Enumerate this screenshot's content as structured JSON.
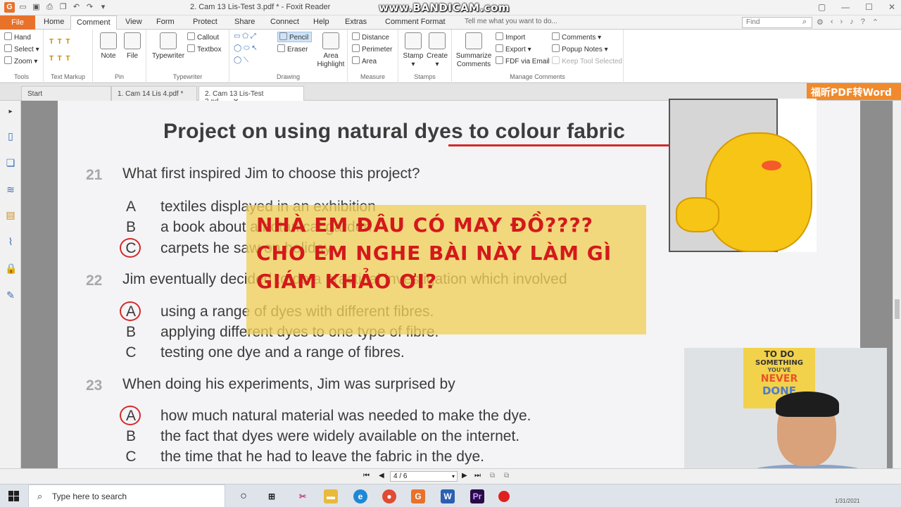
{
  "app": {
    "window_title": "2. Cam 13 Lis-Test 3.pdf * - Foxit Reader",
    "watermark": "www.BANDICAM.com"
  },
  "menu": {
    "tabs": [
      "File",
      "Home",
      "Comment",
      "View",
      "Form",
      "Protect",
      "Share",
      "Connect",
      "Help",
      "Extras",
      "Comment Format"
    ],
    "active_tab": "Comment",
    "tell_me": "Tell me what you want to do...",
    "find_placeholder": "Find"
  },
  "ribbon": {
    "tools": {
      "hand": "Hand",
      "select": "Select",
      "zoom": "Zoom",
      "label": "Tools"
    },
    "text_markup": {
      "label": "Text Markup"
    },
    "pin": {
      "note": "Note",
      "file": "File",
      "label": "Pin"
    },
    "typewriter": {
      "typewriter": "Typewriter",
      "callout": "Callout",
      "textbox": "Textbox",
      "label": "Typewriter"
    },
    "drawing": {
      "pencil": "Pencil",
      "eraser": "Eraser",
      "area_highlight_1": "Area",
      "area_highlight_2": "Highlight",
      "label": "Drawing"
    },
    "measure": {
      "distance": "Distance",
      "perimeter": "Perimeter",
      "area": "Area",
      "label": "Measure"
    },
    "stamps": {
      "stamp": "Stamp",
      "create": "Create",
      "label": "Stamps"
    },
    "manage": {
      "summarize_1": "Summarize",
      "summarize_2": "Comments",
      "import": "Import",
      "export": "Export",
      "fdf": "FDF via Email",
      "comments": "Comments",
      "popup": "Popup Notes",
      "keep": "Keep Tool Selected",
      "label": "Manage Comments"
    }
  },
  "doc_tabs": [
    "Start",
    "1. Cam 14 Lis 4.pdf *",
    "2. Cam 13 Lis-Test 3.pd..."
  ],
  "promo": "福昕PDF转Word",
  "document": {
    "title": "Project on using natural dyes to colour fabric",
    "questions": [
      {
        "num": "21",
        "text": "What first inspired Jim to choose this project?"
      },
      {
        "num": "22",
        "text": "Jim eventually decided to do a practical investigation which involved"
      },
      {
        "num": "23",
        "text": "When doing his experiments, Jim was surprised by"
      }
    ],
    "options": [
      {
        "letter": "A",
        "text": "textiles displayed in an exhibition"
      },
      {
        "letter": "B",
        "text": "a book about a botanical garden"
      },
      {
        "letter": "C",
        "text": "carpets he saw on holiday"
      },
      {
        "letter": "A",
        "text": "using a range of dyes with different fibres."
      },
      {
        "letter": "B",
        "text": "applying different dyes to one type of fibre."
      },
      {
        "letter": "C",
        "text": "testing one dye and a range of fibres."
      },
      {
        "letter": "A",
        "text": "how much natural material was needed to make the dye."
      },
      {
        "letter": "B",
        "text": "the fact that dyes were widely available on the internet."
      },
      {
        "letter": "C",
        "text": "the time that he had to leave the fabric in the dye."
      }
    ]
  },
  "caption": {
    "line1": "NHÀ EM ĐÂU CÓ MAY ĐỒ????",
    "line2": "CHO EM NGHE BÀI NÀY LÀM GÌ",
    "line3": "GIÁM KHẢO ƠI?"
  },
  "webcam_poster": {
    "l1": "TO DO",
    "l2": "SOMETHING",
    "l3": "YOU'VE",
    "l4": "NEVER",
    "l5": "DONE"
  },
  "navigation": {
    "page": "4 / 6"
  },
  "taskbar": {
    "search_placeholder": "Type here to search",
    "date": "1/31/2021"
  },
  "colors": {
    "accent": "#e8722a",
    "caption_text": "#d3191c",
    "caption_bg": "#f1d05a",
    "answer_circle": "#d42a2a"
  }
}
